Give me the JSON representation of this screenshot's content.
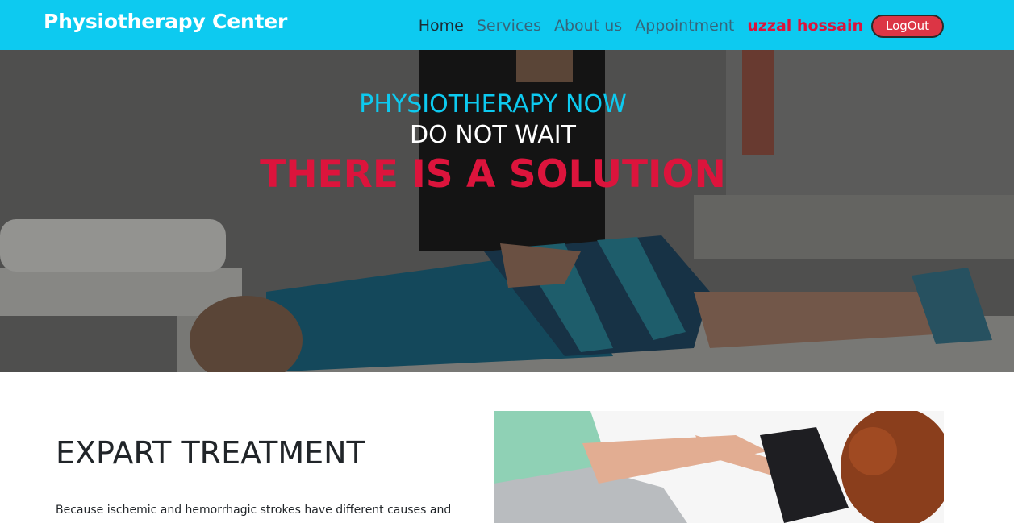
{
  "navbar": {
    "brand": "Physiotherapy Center",
    "links": [
      "Home",
      "Services",
      "About us",
      "Appointment"
    ],
    "user_name": "uzzal hossain",
    "logout_label": "LogOut"
  },
  "hero": {
    "line1": "PHYSIOTHERAPY NOW",
    "line2": "DO NOT WAIT",
    "line3": "THERE IS A SOLUTION"
  },
  "section": {
    "title": "EXPART TREATMENT",
    "text": "Because ischemic and hemorrhagic strokes have different causes and"
  },
  "colors": {
    "navbar_bg": "#0dcaf0",
    "accent_red": "#dc143c",
    "logout_bg": "#dc3545"
  }
}
